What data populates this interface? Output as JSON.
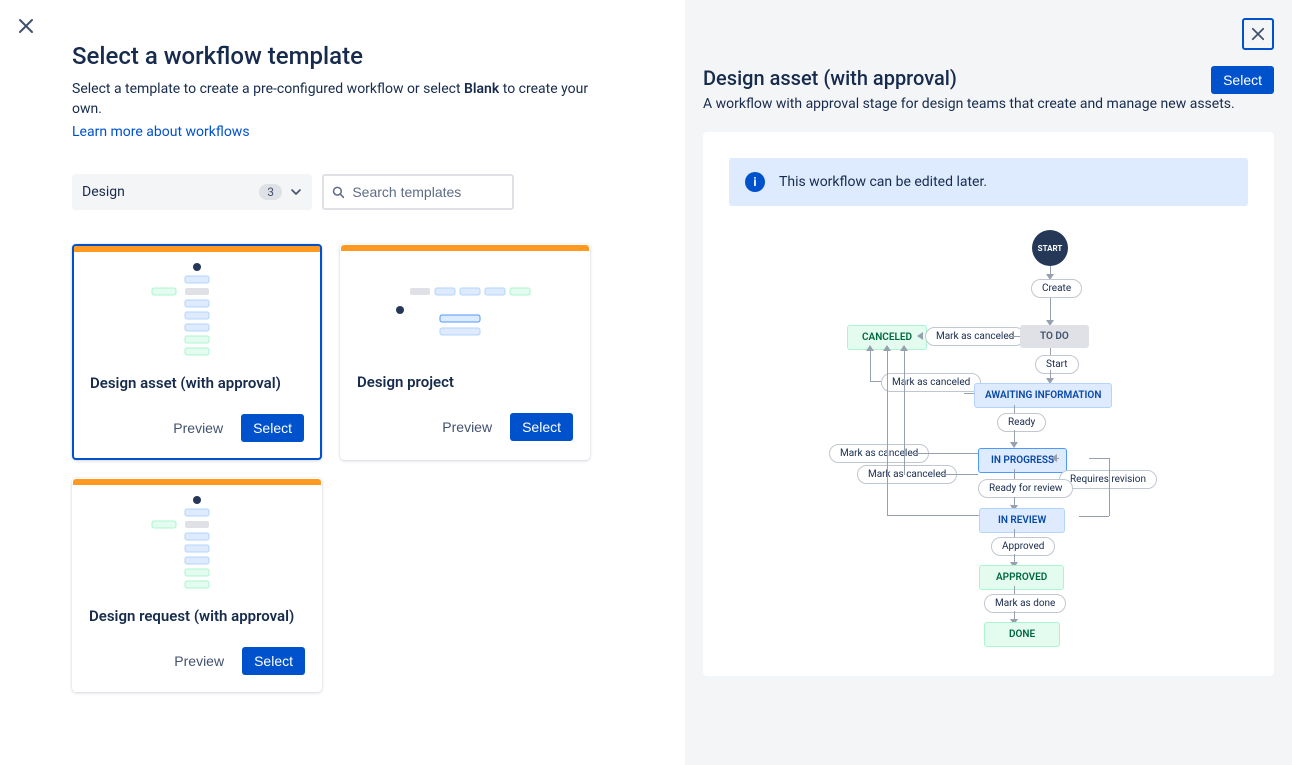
{
  "header": {
    "title": "Select a workflow template",
    "subtitle_pre": "Select a template to create a pre-configured workflow or select ",
    "subtitle_bold": "Blank",
    "subtitle_post": " to create your own.",
    "learn_link": "Learn more about workflows"
  },
  "filter": {
    "category_label": "Design",
    "count": "3",
    "search_placeholder": "Search templates"
  },
  "templates": [
    {
      "title": "Design asset (with approval)",
      "preview": "Preview",
      "select": "Select",
      "selected": true
    },
    {
      "title": "Design project",
      "preview": "Preview",
      "select": "Select",
      "selected": false
    },
    {
      "title": "Design request (with approval)",
      "preview": "Preview",
      "select": "Select",
      "selected": false
    }
  ],
  "detail": {
    "title": "Design asset (with approval)",
    "desc": "A workflow with approval stage for design teams that create and manage new assets.",
    "select_label": "Select",
    "info_text": "This workflow can be edited later."
  },
  "workflow": {
    "start": "START",
    "transitions": {
      "create": "Create",
      "start": "Start",
      "ready": "Ready",
      "ready_for_review": "Ready for review",
      "requires_revision": "Requires revision",
      "approved": "Approved",
      "mark_as_done": "Mark as done",
      "mark_as_canceled_1": "Mark as canceled",
      "mark_as_canceled_2": "Mark as canceled",
      "mark_as_canceled_3": "Mark as canceled",
      "mark_as_canceled_4": "Mark as canceled"
    },
    "statuses": {
      "canceled": "CANCELED",
      "todo": "TO DO",
      "awaiting": "AWAITING INFORMATION",
      "in_progress": "IN PROGRESS",
      "in_review": "IN REVIEW",
      "approved": "APPROVED",
      "done": "DONE"
    }
  }
}
